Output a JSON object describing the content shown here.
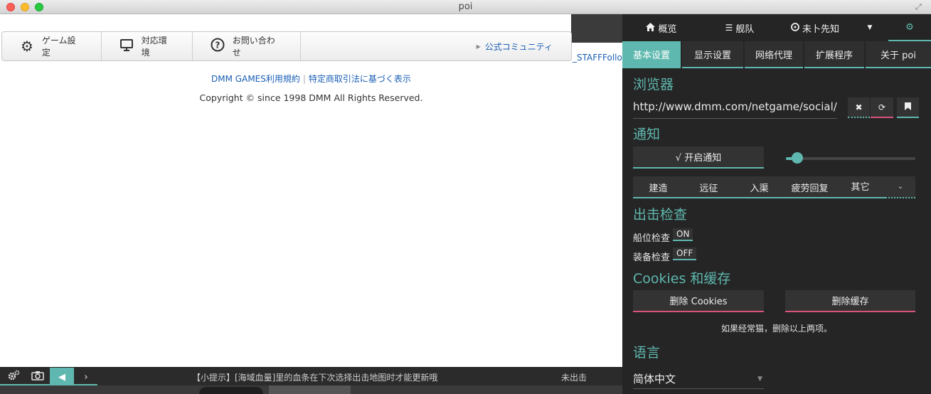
{
  "window": {
    "title": "poi"
  },
  "game_menu": {
    "settings": "ゲーム設定",
    "environment": "対応環境",
    "contact": "お問い合わせ",
    "community": "公式コミュニティ",
    "staff": "_STAFFFollo"
  },
  "footer": {
    "terms": "DMM GAMES利用規約",
    "law": "特定商取引法に基づく表示",
    "copyright": "Copyright © since 1998 DMM All Rights Reserved."
  },
  "bottombar": {
    "tip": "【小提示】[海域血量]里的血条在下次选择出击地图时才能更新哦",
    "status": "未出击"
  },
  "nav": {
    "overview": "概览",
    "fleet": "舰队",
    "expedition": "未卜先知"
  },
  "tabs": [
    {
      "label": "基本设置"
    },
    {
      "label": "显示设置"
    },
    {
      "label": "网络代理"
    },
    {
      "label": "扩展程序"
    },
    {
      "label": "关于 poi"
    }
  ],
  "browser": {
    "heading": "浏览器",
    "url": "http://www.dmm.com/netgame/social/-"
  },
  "notification": {
    "heading": "通知",
    "toggle_label": "√ 开启通知",
    "volume": 0.09,
    "categories": [
      "建造",
      "远征",
      "入渠",
      "疲劳回复",
      "其它"
    ]
  },
  "sortie_check": {
    "heading": "出击检查",
    "ship_slot_label": "船位检查",
    "ship_slot_state": "ON",
    "equip_label": "装备检查",
    "equip_state": "OFF"
  },
  "cache": {
    "heading": "Cookies 和缓存",
    "delete_cookies": "删除 Cookies",
    "delete_cache": "删除缓存",
    "hint": "如果经常猫，删除以上两项。"
  },
  "language": {
    "heading": "语言",
    "selected": "简体中文"
  },
  "colors": {
    "accent": "#5fb8af",
    "danger": "#d9547a",
    "panel_bg": "#252525"
  }
}
